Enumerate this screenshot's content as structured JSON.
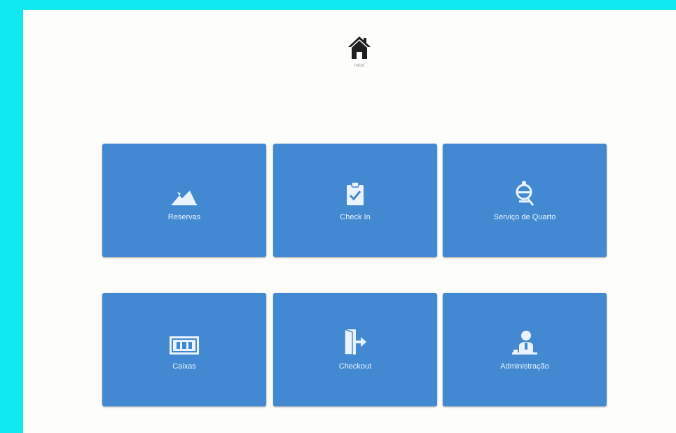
{
  "app": {
    "home_label": "Início"
  },
  "tiles": [
    {
      "label": "Reservas",
      "icon": "reservations-icon"
    },
    {
      "label": "Check In",
      "icon": "clipboard-check-icon"
    },
    {
      "label": "Serviço de Quarto",
      "icon": "room-service-icon"
    },
    {
      "label": "Caixas",
      "icon": "cash-icon"
    },
    {
      "label": "Checkout",
      "icon": "exit-door-icon"
    },
    {
      "label": "Administração",
      "icon": "admin-user-icon"
    }
  ],
  "colors": {
    "frame": "#10e8ef",
    "panel": "#fdfdfb",
    "tile": "#4289d2",
    "icon": "#eaf3ff"
  }
}
